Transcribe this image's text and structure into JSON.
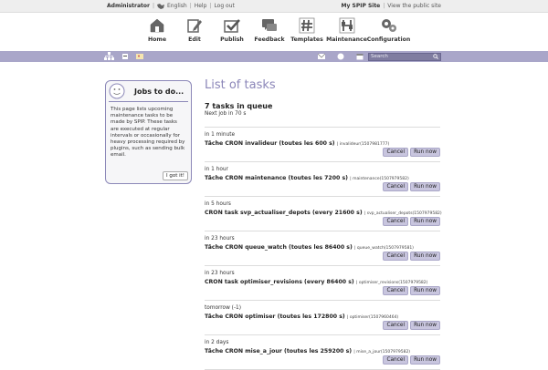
{
  "topbar": {
    "user": "Administrator",
    "language": "English",
    "help": "Help",
    "logout": "Log out",
    "site_name": "My SPIP Site",
    "view_public": "View the public site"
  },
  "menu": [
    {
      "label": "Home",
      "icon": "home-icon"
    },
    {
      "label": "Edit",
      "icon": "pencil-icon"
    },
    {
      "label": "Publish",
      "icon": "checkmark-icon"
    },
    {
      "label": "Feedback",
      "icon": "speech-bubble-icon"
    },
    {
      "label": "Templates",
      "icon": "hash-icon"
    },
    {
      "label": "Maintenance",
      "icon": "sliders-icon"
    },
    {
      "label": "Configuration",
      "icon": "gears-icon"
    }
  ],
  "search": {
    "placeholder": "Search"
  },
  "sidebox": {
    "title": "Jobs to do...",
    "body": "This page lists upcoming maintenance tasks to be made by SPIP. These tasks are executed at regular intervals or occasionally for heavy processing required by plugins, such as sending bulk email.",
    "button": "I got it!"
  },
  "main": {
    "title": "List of tasks",
    "count": "7 tasks in queue",
    "next": "Next job in 70 s"
  },
  "tasks": [
    {
      "when": "in 1 minute",
      "name": "Tâche CRON invalideur (toutes les 600 s)",
      "detail": "| invalideur(1507981777)"
    },
    {
      "when": "in 1 hour",
      "name": "Tâche CRON maintenance (toutes les 7200 s)",
      "detail": "| maintenance(1507979582)"
    },
    {
      "when": "in 5 hours",
      "name": "CRON task svp_actualiser_depots (every 21600 s)",
      "detail": "| svp_actualiser_depots(1507979582)"
    },
    {
      "when": "in 23 hours",
      "name": "Tâche CRON queue_watch (toutes les 86400 s)",
      "detail": "| queue_watch(1507979581)"
    },
    {
      "when": "in 23 hours",
      "name": "CRON task optimiser_revisions (every 86400 s)",
      "detail": "| optimiser_revisions(1507979582)"
    },
    {
      "when": "tomorrow (-1)",
      "name": "Tâche CRON optimiser (toutes les 172800 s)",
      "detail": "| optimiser(1507960464)"
    },
    {
      "when": "in 2 days",
      "name": "Tâche CRON mise_a_jour (toutes les 259200 s)",
      "detail": "| mise_a_jour(1507979582)"
    }
  ],
  "buttons": {
    "cancel": "Cancel",
    "run": "Run now"
  },
  "colors": {
    "accent": "#a9a6c9",
    "title": "#8b86b8",
    "button": "#c8c5de"
  }
}
